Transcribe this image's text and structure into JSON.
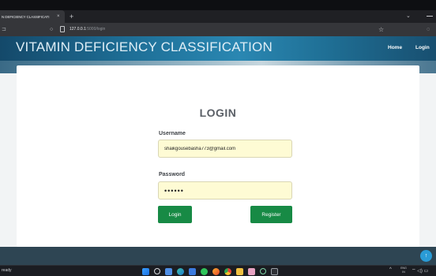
{
  "browser": {
    "tab_title": "N DEFICIENCY CLASSIFICATI",
    "tab_close": "×",
    "new_tab": "+",
    "url_host": "127.0.0.1",
    "url_path": ":5000/login",
    "icons": [
      "close-icon",
      "plus-icon",
      "chevron-down-icon",
      "minimize-icon",
      "back-icon",
      "reload-icon",
      "page-info-icon",
      "star-icon",
      "extension-icon"
    ]
  },
  "site": {
    "title": "VITAMIN DEFICIENCY CLASSIFICATION",
    "nav": {
      "home": "Home",
      "login": "Login"
    }
  },
  "form": {
    "heading": "LOGIN",
    "username_label": "Username",
    "username_value": "shaikgousebasha773@gmail.com",
    "password_label": "Password",
    "password_value": "••••••",
    "login_button": "Login",
    "register_button": "Register"
  },
  "footer": {
    "scroll_top_icon": "arrow-up-icon"
  },
  "taskbar": {
    "status_text": "ready",
    "tray_lang_1": "ENG",
    "tray_lang_2": "IN",
    "tray_chevron": "^",
    "tray_icons_text": "⌔ ◁) ▭"
  },
  "colors": {
    "header_blue": "#1e6f97",
    "button_green": "#178a45",
    "field_yellow": "#fefbd4",
    "footer_dark": "#2e4553",
    "scroll_button": "#2a9bd6"
  }
}
